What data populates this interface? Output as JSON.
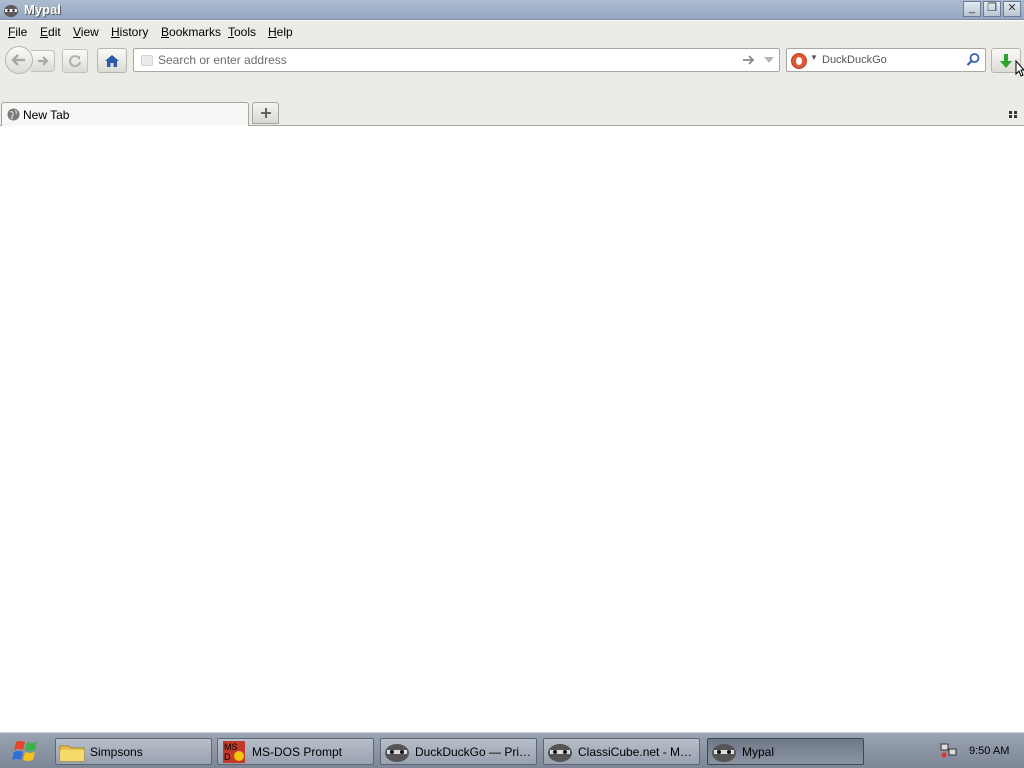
{
  "window": {
    "title": "Mypal",
    "minimize_icon": "minimize-icon",
    "restore_icon": "restore-icon",
    "close_icon": "close-icon"
  },
  "menu": {
    "items": [
      "File",
      "Edit",
      "View",
      "History",
      "Bookmarks",
      "Tools",
      "Help"
    ]
  },
  "navbar": {
    "url_placeholder": "Search or enter address",
    "url_value": "",
    "search_engine": "DuckDuckGo",
    "search_placeholder": "DuckDuckGo",
    "icons": [
      "back-icon",
      "forward-icon",
      "reload-icon",
      "home-icon",
      "go-arrow-icon",
      "history-dropdown-icon",
      "search-magnifier-icon",
      "download-icon"
    ]
  },
  "tabs": {
    "items": [
      {
        "label": "New Tab",
        "active": true
      }
    ],
    "new_tab_icon": "plus-icon"
  },
  "taskbar": {
    "tasks": [
      {
        "label": "Simpsons",
        "icon": "folder-icon",
        "active": false
      },
      {
        "label": "MS-DOS Prompt",
        "icon": "msdos-icon",
        "active": false
      },
      {
        "label": "DuckDuckGo — Priva...",
        "icon": "raccoon-icon",
        "active": false
      },
      {
        "label": "ClassiCube.net - Mypal",
        "icon": "raccoon-icon",
        "active": false
      },
      {
        "label": "Mypal",
        "icon": "raccoon-icon",
        "active": true
      }
    ],
    "clock": "9:50 AM"
  },
  "colors": {
    "chrome": "#ecebe6",
    "titlebar": "#aebcd0",
    "taskbar": "#8a94a2",
    "download_green": "#2aa52a",
    "duckduckgo_orange": "#de5833",
    "home_blue": "#2b5aa8"
  }
}
